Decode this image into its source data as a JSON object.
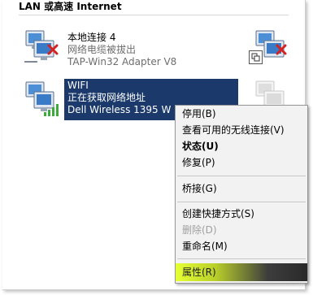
{
  "group": {
    "header": "LAN 或高速 Internet"
  },
  "connections": [
    {
      "name": "本地连接 4",
      "status": "网络电缆被拔出",
      "device": "TAP-Win32 Adapter V8"
    },
    {
      "name": "WIFI",
      "status": "正在获取网络地址",
      "device": "Dell Wireless 1395 W"
    }
  ],
  "context_menu": {
    "items": [
      {
        "label": "停用(B)"
      },
      {
        "label": "查看可用的无线连接(V)"
      },
      {
        "label": "状态(U)"
      },
      {
        "label": "修复(P)"
      },
      {
        "label": "桥接(G)"
      },
      {
        "label": "创建快捷方式(S)"
      },
      {
        "label": "删除(D)"
      },
      {
        "label": "重命名(M)"
      },
      {
        "label": "属性(R)"
      }
    ]
  },
  "icons": {
    "network": "network-computer-icon",
    "disconnected": "red-x-icon",
    "signal": "wireless-signal-icon",
    "shortcut": "shortcut-arrow-icon"
  },
  "colors": {
    "selection": "#1b3a6b",
    "menu_bg": "#f2f2f2",
    "hover_start": "#e6ff33",
    "error_x": "#d22222"
  }
}
